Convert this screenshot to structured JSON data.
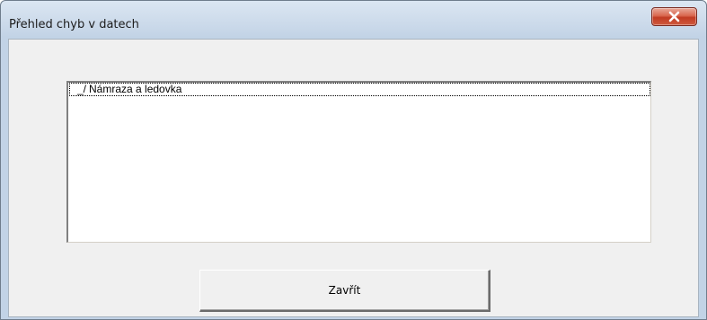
{
  "window": {
    "title": "Přehled chyb v datech"
  },
  "titlebar": {
    "close_icon": "close-icon"
  },
  "list": {
    "items": [
      {
        "prefix": "_/",
        "label": "Námraza a ledovka",
        "selected": true
      }
    ]
  },
  "buttons": {
    "close_label": "Zavřít"
  },
  "colors": {
    "titlebar": "#c9d8e9",
    "client": "#f0f0f0",
    "close_button_red": "#c13b23"
  }
}
